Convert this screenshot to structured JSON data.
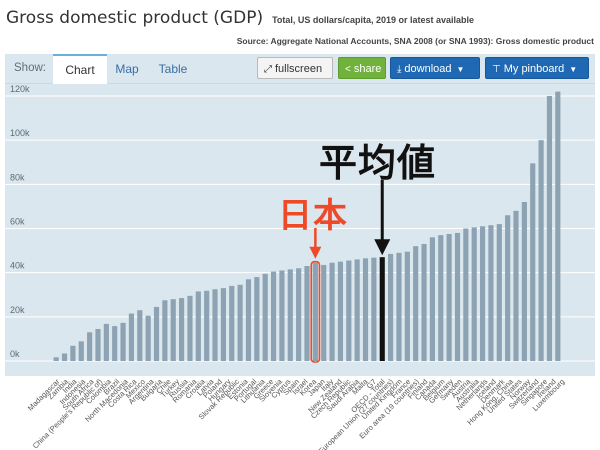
{
  "header": {
    "title": "Gross domestic product (GDP)",
    "subtitle": "Total, US dollars/capita, 2019 or latest available",
    "source": "Source: Aggregate National Accounts, SNA 2008 (or SNA 1993): Gross domestic product"
  },
  "toolbar": {
    "show_label": "Show:",
    "tabs": [
      {
        "label": "Chart",
        "active": true
      },
      {
        "label": "Map",
        "active": false
      },
      {
        "label": "Table",
        "active": false
      }
    ],
    "fullscreen_label": "fullscreen",
    "share_label": "share",
    "download_label": "download",
    "pinboard_label": "My pinboard"
  },
  "annotations": {
    "japan_label": "日本",
    "average_label": "平均値",
    "japan_color": "#ee4a28",
    "average_color": "#111111"
  },
  "colors": {
    "bar": "#8da3b3",
    "plot_background": "#dbe7ee",
    "share_button": "#70b23b",
    "primary_button": "#1f68b3"
  },
  "chart_data": {
    "type": "bar",
    "ylim": [
      0,
      120000
    ],
    "yticks": [
      {
        "value": 0,
        "label": "0k"
      },
      {
        "value": 20000,
        "label": "20k"
      },
      {
        "value": 40000,
        "label": "40k"
      },
      {
        "value": 60000,
        "label": "60k"
      },
      {
        "value": 80000,
        "label": "80k"
      },
      {
        "value": 100000,
        "label": "100k"
      },
      {
        "value": 120000,
        "label": "120k"
      }
    ],
    "grid": true,
    "highlights": {
      "japan": "Japan",
      "average": "OECD - Total"
    },
    "categories": [
      "Madagascar",
      "Zambia",
      "India",
      "Indonesia",
      "South Africa",
      "Colombia",
      "China (People's Republic of)",
      "Brazil",
      "North Macedonia",
      "Costa Rica",
      "Argentina",
      "Mexico",
      "Bulgaria",
      "Turkey",
      "Chile",
      "Romania",
      "Russia",
      "Croatia",
      "Latvia",
      "Greece",
      "Poland",
      "Hungary",
      "Slovak Republic",
      "Estonia",
      "Portugal",
      "Lithuania",
      "Slovenia",
      "Czech Republic",
      "Spain",
      "Israel",
      "Korea",
      "Japan",
      "Italy",
      "New Zealand",
      "Cyprus",
      "United Kingdom",
      "Saudi Arabia",
      "European Union (27 countries)",
      "G7",
      "OECD - Total",
      "France",
      "Canada",
      "Finland",
      "Belgium",
      "Euro area (19 countries)",
      "Germany",
      "Austria",
      "Australia",
      "Sweden",
      "Iceland",
      "Netherlands",
      "Denmark",
      "Hong Kong, China",
      "Singapore",
      "Norway",
      "United States",
      "Switzerland",
      "Qatar",
      "Brunei",
      "Macau, China",
      "Ireland",
      "Luxembourg"
    ],
    "labeled_categories": [
      "Madagascar",
      "Zambia",
      "India",
      "Indonesia",
      "South Africa",
      "China (People's Republic of)",
      "Colombia",
      "Brazil",
      "North Macedonia",
      "Costa Rica",
      "Mexico",
      "Argentina",
      "Bulgaria",
      "Chile",
      "Turkey",
      "Russia",
      "Romania",
      "Croatia",
      "Latvia",
      "Poland",
      "Hungary",
      "Slovak Republic",
      "Estonia",
      "Portugal",
      "Lithuania",
      "Greece",
      "Slovenia",
      "Cyprus",
      "Spain",
      "Israel",
      "Korea",
      "Japan",
      "Italy",
      "New Zealand",
      "Czech Republic",
      "Saudi Arabia",
      "Malta",
      "G7",
      "OECD - Total",
      "European Union (27 countries)",
      "United Kingdom",
      "France",
      "Euro area (19 countries)",
      "Finland",
      "Canada",
      "Belgium",
      "Germany",
      "Sweden",
      "Austria",
      "Australia",
      "Netherlands",
      "Iceland",
      "Denmark",
      "Hong Kong, China",
      "United States",
      "Norway",
      "Switzerland",
      "Singapore",
      "Ireland",
      "Luxembourg"
    ],
    "values": [
      1700,
      3400,
      6900,
      8900,
      13000,
      14500,
      16800,
      15800,
      17300,
      21500,
      23000,
      20500,
      24500,
      27500,
      28000,
      28500,
      29500,
      31500,
      31800,
      32500,
      33000,
      34000,
      34500,
      37000,
      38000,
      39500,
      40500,
      41000,
      41500,
      42000,
      43000,
      44500,
      43500,
      44500,
      45000,
      45500,
      46000,
      46500,
      46800,
      47000,
      48500,
      49000,
      49500,
      52000,
      53000,
      56000,
      57000,
      57500,
      58000,
      60000,
      60500,
      61000,
      61500,
      62000,
      66000,
      68000,
      72000,
      89500,
      100000,
      120000,
      122000
    ]
  }
}
